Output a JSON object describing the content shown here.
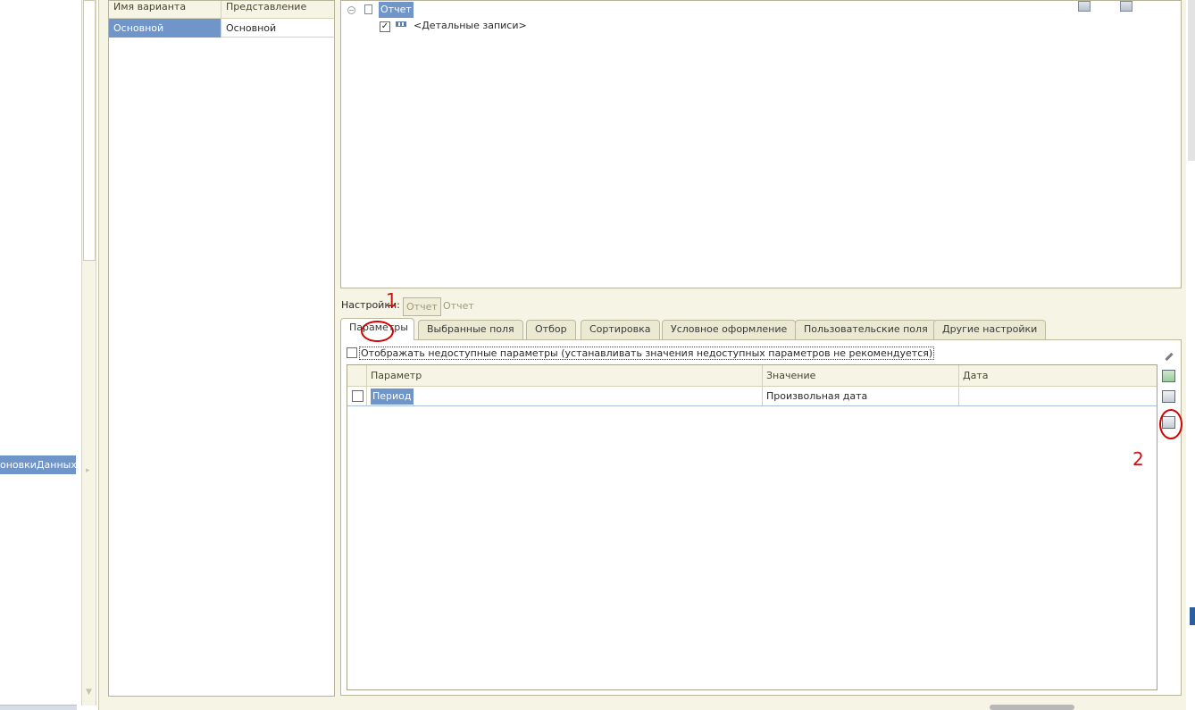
{
  "left_pane": {
    "selected_item": "оновкиДанных"
  },
  "variants": {
    "columns": [
      "Имя варианта",
      "Представление"
    ],
    "rows": [
      {
        "name": "Основной",
        "presentation": "Основной"
      }
    ]
  },
  "structure_tree": {
    "root_label": "Отчет",
    "child_label": "<Детальные записи>"
  },
  "settings": {
    "label": "Настройки:",
    "pills": [
      "Отчет",
      "Отчет"
    ]
  },
  "tabs": [
    "Параметры",
    "Выбранные поля",
    "Отбор",
    "Сортировка",
    "Условное оформление",
    "Пользовательские поля",
    "Другие настройки"
  ],
  "parameters_tab": {
    "show_unavailable_label": "Отображать недоступные параметры (устанавливать значения недоступных параметров не рекомендуется)",
    "columns": [
      "Параметр",
      "Значение",
      "Дата"
    ],
    "rows": [
      {
        "parameter": "Период",
        "value": "Произвольная дата",
        "date": ""
      }
    ]
  },
  "annotations": [
    "1",
    "2"
  ],
  "colors": {
    "selection": "#6f95c9",
    "panel_bg": "#f6f4e4",
    "annotation": "#cc1111"
  }
}
